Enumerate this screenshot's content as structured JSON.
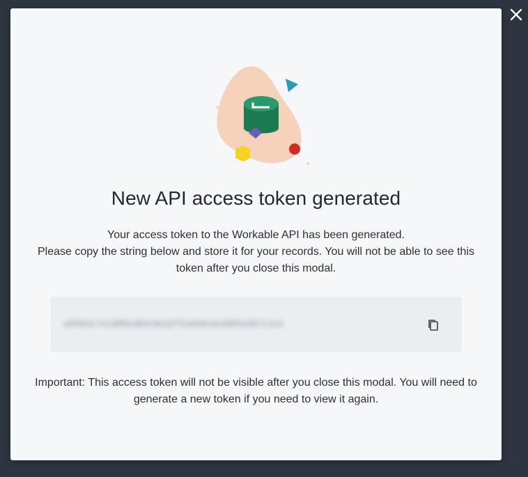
{
  "modal": {
    "title": "New API access token generated",
    "description_line1": "Your access token to the Workable API has been generated.",
    "description_line2": "Please copy the string below and store it for your records. You will not be able to see this token after you close this modal.",
    "token_value": "a9f4b2c7e1d8f6a3b5c9e2d7f1a4b8c6e3d9f2a5b7c1e4",
    "note": "Important: This access token will not be visible after you close this modal. You will need to generate a new token if you need to view it again."
  },
  "icons": {
    "close": "close-icon",
    "copy": "copy-icon"
  },
  "colors": {
    "overlay": "#2f3540",
    "modal_bg": "#f6f7f9",
    "token_bg": "#eaeef0",
    "blob": "#f7d2bb",
    "cylinder": "#1e7a54",
    "accent_red": "#d42d20",
    "accent_yellow": "#f5d31e",
    "accent_teal": "#2a9db6",
    "accent_purple": "#6a5fb7"
  }
}
